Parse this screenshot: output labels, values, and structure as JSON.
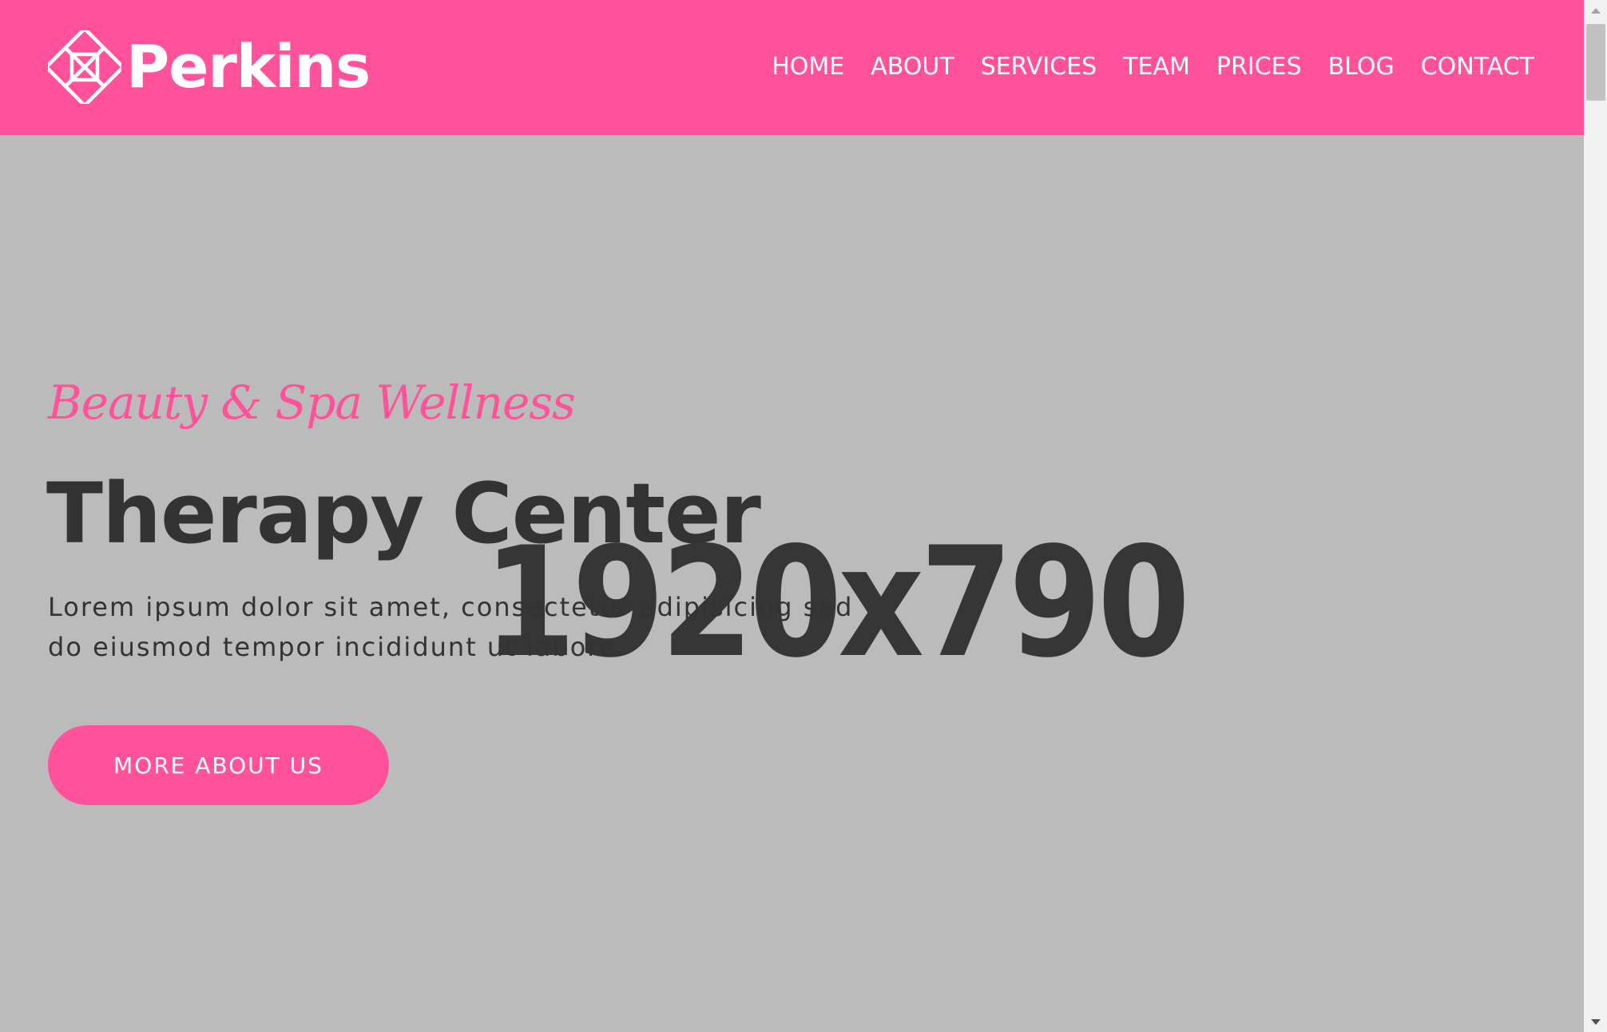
{
  "brand": {
    "name": "Perkins",
    "color": "#ff529a",
    "logo_icon": "interlocking-diamond-logo-icon"
  },
  "nav": {
    "items": [
      "HOME",
      "ABOUT",
      "SERVICES",
      "TEAM",
      "PRICES",
      "BLOG",
      "CONTACT"
    ]
  },
  "hero": {
    "background_placeholder": "1920x790",
    "tagline": "Beauty & Spa Wellness",
    "headline": "Therapy Center",
    "lead": "Lorem ipsum dolor sit amet, consectetur adipisicing sed do eiusmod tempor incididunt ut labore.",
    "cta_label": "MORE ABOUT US"
  },
  "colors": {
    "accent": "#ff529a",
    "hero_bg": "#bbbbbb",
    "text_dark": "#333333"
  },
  "scrollbar": {
    "up_icon": "arrow-up-icon",
    "down_icon": "arrow-down-icon"
  }
}
